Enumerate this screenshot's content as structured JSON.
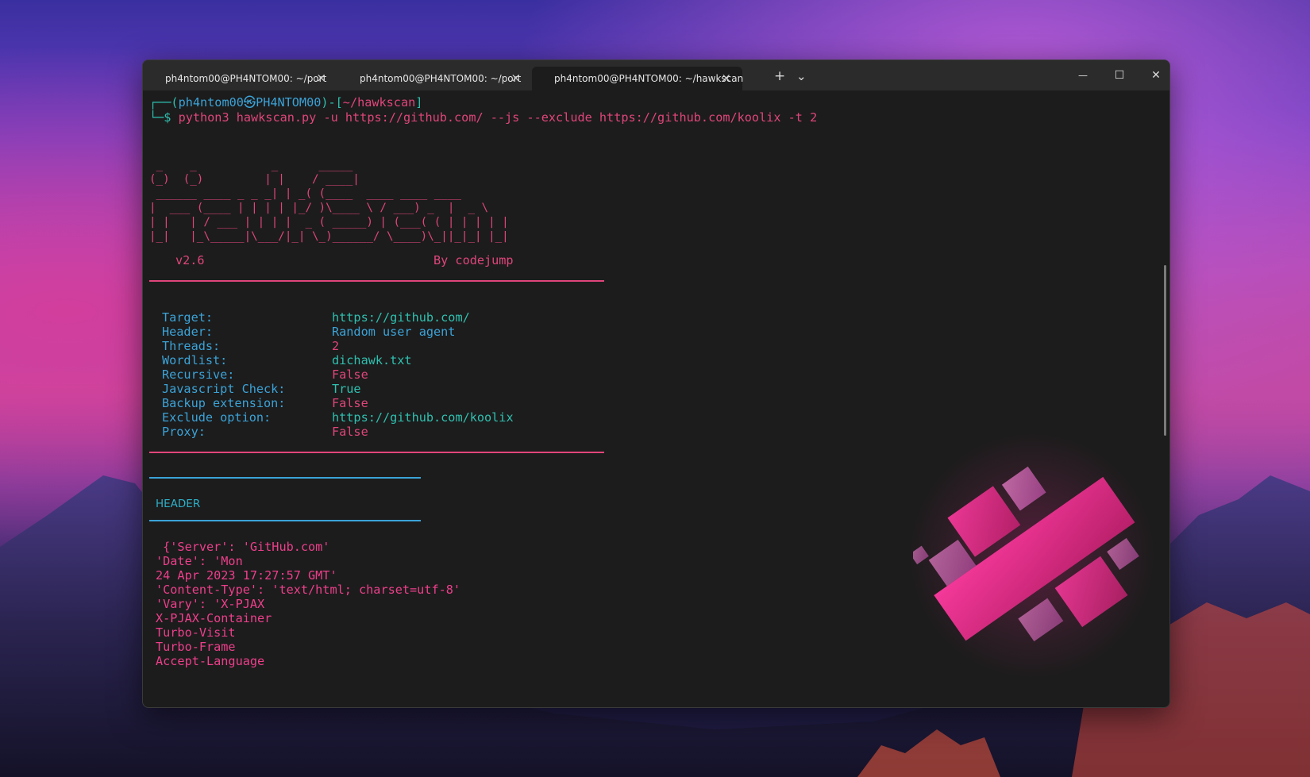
{
  "tabs": [
    {
      "label": "ph4ntom00@PH4NTOM00: ~/port"
    },
    {
      "label": "ph4ntom00@PH4NTOM00: ~/port"
    },
    {
      "label": "ph4ntom00@PH4NTOM00: ~/hawkscan"
    }
  ],
  "icons": {
    "close": "×",
    "new_tab": "+",
    "dropdown": "⌄",
    "minimize": "—",
    "maximize": "☐",
    "window_close": "✕"
  },
  "prompt": {
    "corner_top": "┌──(",
    "user": "ph4ntom00",
    "at": "㉿",
    "host": "PH4NTOM00",
    "mid": ")-[",
    "path": "~/hawkscan",
    "end": "]",
    "corner_bottom": "└─$ ",
    "command": "python3 hawkscan.py -u https://github.com/ --js --exclude https://github.com/koolix -t 2"
  },
  "banner_ascii": " _    _           _      _____                 \n(_)  (_)         | |    / ____|                \n ______ ____ _ _ _| | _( (____  ____ ____ ____ \n|  ___ (____ | | | | |_/ )\\____ \\ / ___) _  |  _ \\\n| |   | / ___ | | | |  _ ( _____) | (___( ( | | | | |\n|_|   |_\\_____|\\___/|_| \\_)______/ \\____)\\_||_|_| |_|",
  "version": "v2.6",
  "author": "By codejump",
  "config": [
    {
      "key": "Target:",
      "value": "https://github.com/",
      "color": "#2fc0b0"
    },
    {
      "key": "Header:",
      "value": "Random user agent",
      "color": "#3ba3d8"
    },
    {
      "key": "Threads:",
      "value": "2",
      "color": "#e0457b"
    },
    {
      "key": "Wordlist:",
      "value": "dichawk.txt",
      "color": "#2fc0b0"
    },
    {
      "key": "Recursive:",
      "value": "False",
      "color": "#e0457b"
    },
    {
      "key": "Javascript Check:",
      "value": "True",
      "color": "#2fc0b0"
    },
    {
      "key": "Backup extension:",
      "value": "False",
      "color": "#e0457b"
    },
    {
      "key": "Exclude option:",
      "value": "https://github.com/koolix",
      "color": "#2fc0b0"
    },
    {
      "key": "Proxy:",
      "value": "False",
      "color": "#e0457b"
    }
  ],
  "section_header": "HEADER",
  "header_lines": [
    " {'Server': 'GitHub.com'",
    "'Date': 'Mon",
    "24 Apr 2023 17:27:57 GMT'",
    "'Content-Type': 'text/html; charset=utf-8'",
    "'Vary': 'X-PJAX",
    "X-PJAX-Container",
    "Turbo-Visit",
    "Turbo-Frame",
    "Accept-Language"
  ]
}
